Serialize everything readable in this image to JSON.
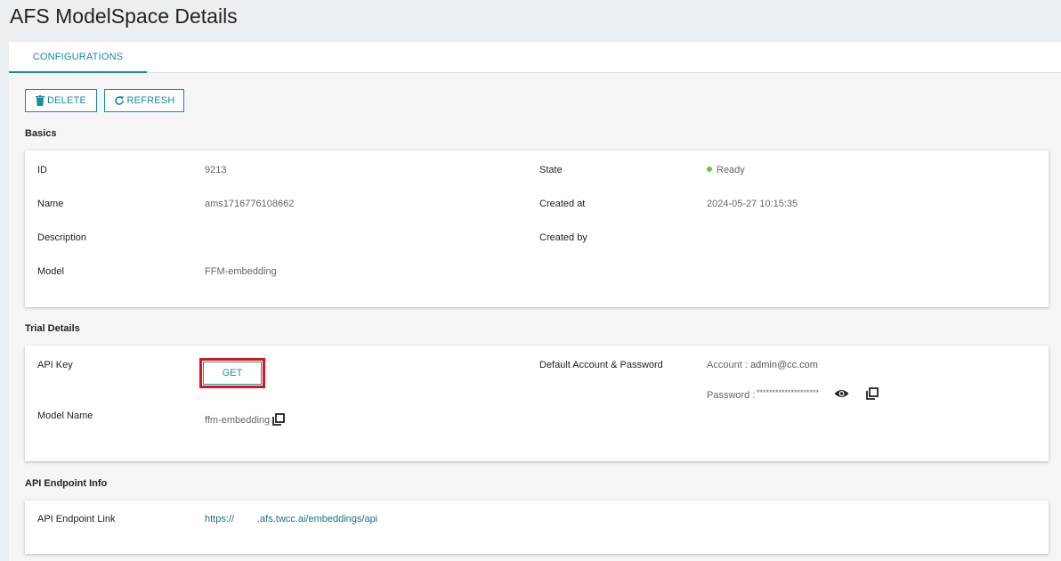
{
  "page": {
    "title": "AFS ModelSpace Details"
  },
  "tabs": [
    {
      "label": "CONFIGURATIONS"
    }
  ],
  "toolbar": {
    "delete_label": "DELETE",
    "refresh_label": "REFRESH"
  },
  "basics": {
    "title": "Basics",
    "id_label": "ID",
    "id_value": "9213",
    "name_label": "Name",
    "name_value": "ams1716776108662",
    "description_label": "Description",
    "description_value": "",
    "model_label": "Model",
    "model_value": "FFM-embedding",
    "state_label": "State",
    "state_value": "Ready",
    "created_at_label": "Created at",
    "created_at_value": "2024-05-27 10:15:35",
    "created_by_label": "Created by",
    "created_by_value": ""
  },
  "trial": {
    "title": "Trial Details",
    "api_key_label": "API Key",
    "get_label": "GET",
    "model_name_label": "Model Name",
    "model_name_value": "ffm-embedding",
    "default_account_label": "Default Account & Password",
    "account_label": "Account :",
    "account_value": "admin@cc.com",
    "password_label": "Password :",
    "password_value": "********************"
  },
  "endpoint": {
    "title": "API Endpoint Info",
    "link_label": "API Endpoint Link",
    "link_prefix": "https://",
    "link_suffix": ".afs.twcc.ai/embeddings/api"
  },
  "colors": {
    "accent": "#1a8ba3",
    "status_ready": "#6cc644",
    "highlight": "#d7161f"
  }
}
